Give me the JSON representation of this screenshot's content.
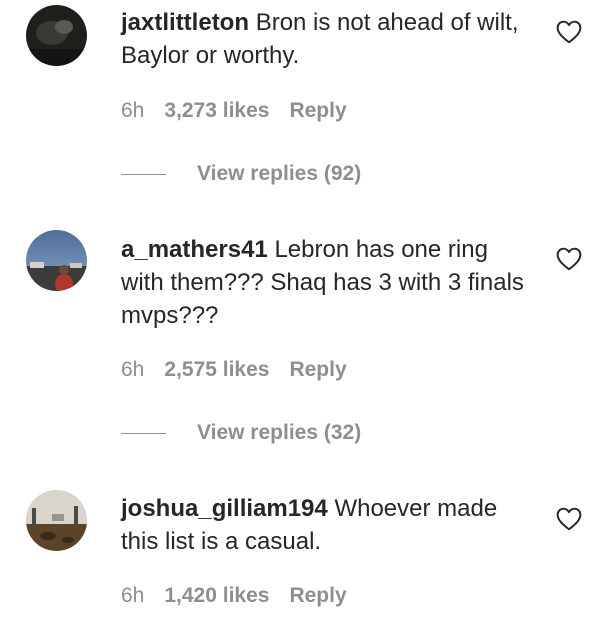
{
  "colors": {
    "text": "#262626",
    "secondary": "#8e8e8e",
    "background": "#ffffff"
  },
  "comments": [
    {
      "username": "jaxtlittleton",
      "text": "Bron is not ahead of wilt, Baylor or worthy.",
      "time": "6h",
      "likes": "3,273 likes",
      "reply": "Reply",
      "view_replies": "View replies (92)",
      "icon": "heart-outline-icon"
    },
    {
      "username": "a_mathers41",
      "text": "Lebron has one ring with them??? Shaq has 3 with 3 finals mvps???",
      "time": "6h",
      "likes": "2,575 likes",
      "reply": "Reply",
      "view_replies": "View replies (32)",
      "icon": "heart-outline-icon"
    },
    {
      "username": "joshua_gilliam194",
      "text": "Whoever made this list is a casual.",
      "time": "6h",
      "likes": "1,420 likes",
      "reply": "Reply",
      "icon": "heart-outline-icon"
    }
  ]
}
